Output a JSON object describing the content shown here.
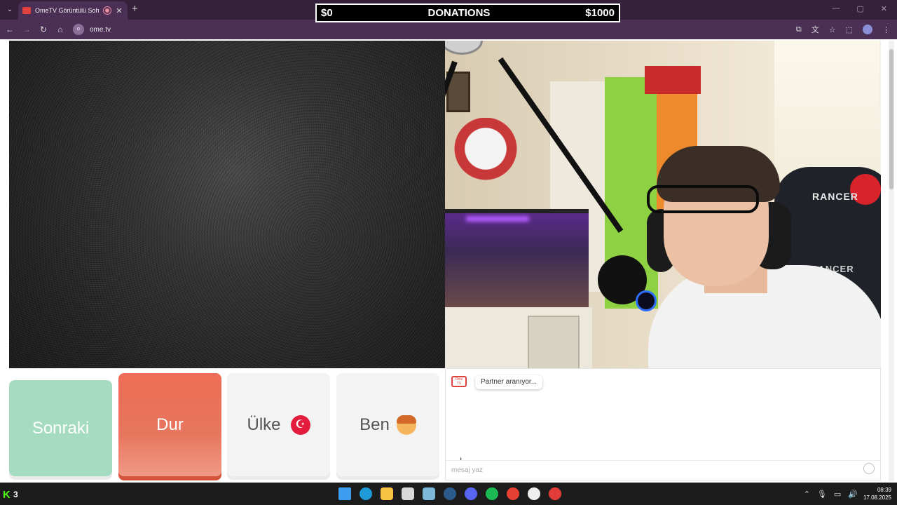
{
  "browser": {
    "tab_title": "OmeTV Görüntülü Sohbet -",
    "tab_close": "✕",
    "new_tab": "+",
    "url": "ome.tv",
    "site_icon_text": "o"
  },
  "overlay": {
    "donations_min": "$0",
    "donations_title": "DONATIONS",
    "donations_max": "$1000"
  },
  "webcam": {
    "chair_brand": "RANCER"
  },
  "buttons": {
    "next": "Sonraki",
    "stop": "Dur",
    "country": "Ülke",
    "country_flag": "☪",
    "me": "Ben"
  },
  "chat": {
    "logo_text": "Ome TV",
    "status_message": "Partner aranıyor...",
    "input_placeholder": "mesaj yaz"
  },
  "taskbar": {
    "kick_logo": "K",
    "kick_count": "3",
    "time": "08:39",
    "date": "17.08.2025",
    "icons": [
      {
        "name": "windows-start-icon",
        "color": "#3b9cf0"
      },
      {
        "name": "edge-icon",
        "color": "#1e9ad6"
      },
      {
        "name": "file-explorer-icon",
        "color": "#f5c542"
      },
      {
        "name": "store-icon",
        "color": "#d9d9d9"
      },
      {
        "name": "game-icon",
        "color": "#7fb7d9"
      },
      {
        "name": "steam-icon",
        "color": "#2a5a8a"
      },
      {
        "name": "discord-icon",
        "color": "#5865f2"
      },
      {
        "name": "spotify-icon",
        "color": "#1db954"
      },
      {
        "name": "chrome-icon",
        "color": "#e34133"
      },
      {
        "name": "obs-icon",
        "color": "#efefef"
      },
      {
        "name": "app-red-icon",
        "color": "#e23b3b"
      }
    ]
  }
}
